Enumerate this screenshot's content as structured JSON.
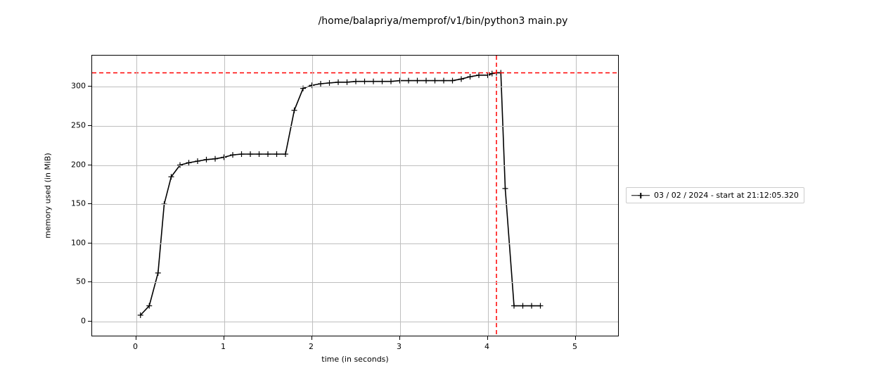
{
  "chart_data": {
    "type": "line",
    "title": "/home/balapriya/memprof/v1/bin/python3 main.py",
    "xlabel": "time (in seconds)",
    "ylabel": "memory used (in MiB)",
    "xlim": [
      -0.5,
      5.5
    ],
    "ylim": [
      -20,
      340
    ],
    "grid": true,
    "legend_position": "right",
    "x": [
      0.05,
      0.15,
      0.25,
      0.32,
      0.4,
      0.5,
      0.6,
      0.7,
      0.8,
      0.9,
      1.0,
      1.1,
      1.2,
      1.3,
      1.4,
      1.5,
      1.6,
      1.7,
      1.8,
      1.9,
      2.0,
      2.1,
      2.2,
      2.3,
      2.4,
      2.5,
      2.6,
      2.7,
      2.8,
      2.9,
      3.0,
      3.1,
      3.2,
      3.3,
      3.4,
      3.5,
      3.6,
      3.7,
      3.8,
      3.9,
      4.0,
      4.05,
      4.1,
      4.15,
      4.2,
      4.3,
      4.4,
      4.5,
      4.6
    ],
    "values": [
      8,
      20,
      62,
      150,
      185,
      200,
      203,
      205,
      207,
      208,
      210,
      213,
      214,
      214,
      214,
      214,
      214,
      214,
      270,
      298,
      302,
      304,
      305,
      306,
      306,
      307,
      307,
      307,
      307,
      307,
      308,
      308,
      308,
      308,
      308,
      308,
      308,
      310,
      313,
      315,
      315,
      317,
      318,
      318,
      170,
      20,
      20,
      20,
      20
    ],
    "peak_time": 4.1,
    "peak_mem": 318,
    "series": [
      {
        "name": "03 / 02 / 2024 - start at 21:12:05.320"
      }
    ],
    "xticks": [
      0,
      1,
      2,
      3,
      4,
      5
    ],
    "yticks": [
      0,
      50,
      100,
      150,
      200,
      250,
      300
    ]
  },
  "legend": {
    "label": "03 / 02 / 2024 - start at 21:12:05.320"
  }
}
